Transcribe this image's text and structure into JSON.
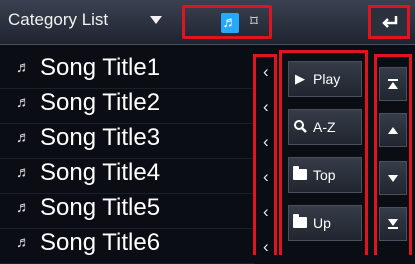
{
  "header": {
    "title": "Category List",
    "mode_icons": [
      {
        "name": "music-icon",
        "glyph": "♬",
        "active": true
      },
      {
        "name": "video-icon",
        "glyph": "⌑",
        "active": false
      }
    ],
    "back_icon": "return-arrow-icon"
  },
  "list": {
    "items": [
      {
        "label": "Song Title1",
        "icon": "music-note-icon"
      },
      {
        "label": "Song Title2",
        "icon": "music-note-icon"
      },
      {
        "label": "Song Title3",
        "icon": "music-note-icon"
      },
      {
        "label": "Song Title4",
        "icon": "music-note-icon"
      },
      {
        "label": "Song Title5",
        "icon": "music-note-icon"
      },
      {
        "label": "Song Title6",
        "icon": "music-note-icon"
      }
    ]
  },
  "side_buttons": [
    {
      "label": "Play",
      "icon": "play-icon"
    },
    {
      "label": "A-Z",
      "icon": "search-icon"
    },
    {
      "label": "Top",
      "icon": "folder-icon"
    },
    {
      "label": "Up",
      "icon": "folder-icon"
    }
  ],
  "scroll_buttons": [
    {
      "name": "page-up-first",
      "icon": "scroll-top-icon"
    },
    {
      "name": "page-up",
      "icon": "scroll-up-icon"
    },
    {
      "name": "page-down",
      "icon": "scroll-down-icon"
    },
    {
      "name": "page-down-last",
      "icon": "scroll-bottom-icon"
    }
  ],
  "colors": {
    "accent_highlight": "#e0141e",
    "music_icon_active": "#26a8ff",
    "background": "#0a0d14"
  }
}
